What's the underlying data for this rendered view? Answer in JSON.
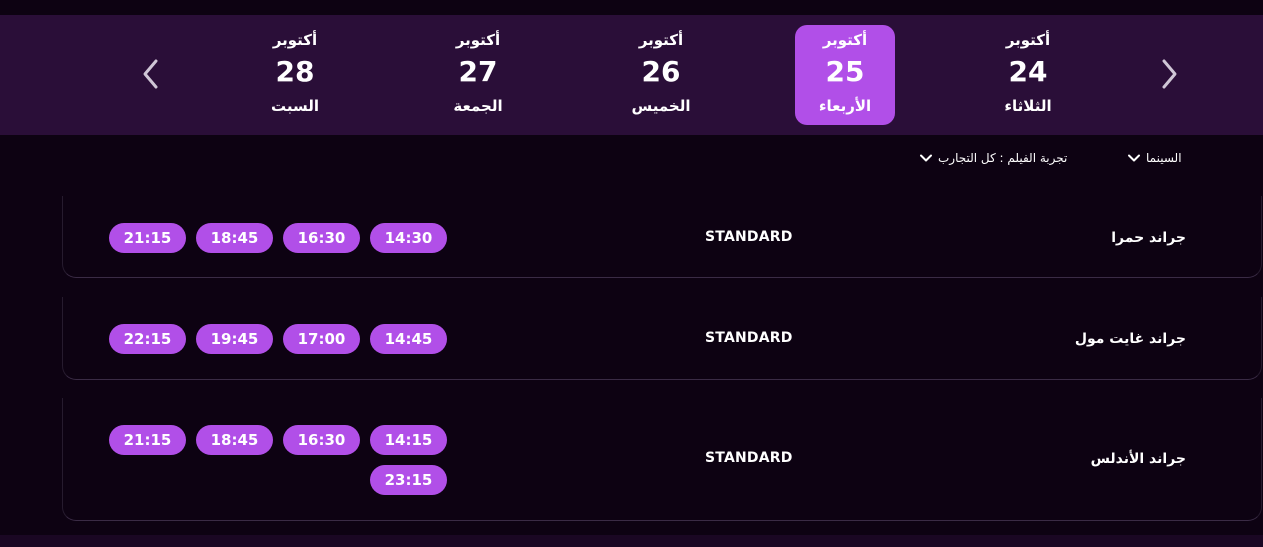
{
  "dates": [
    {
      "month": "أكتوبر",
      "day": "24",
      "weekday": "الثلاثاء",
      "selected": false
    },
    {
      "month": "أكتوبر",
      "day": "25",
      "weekday": "الأربعاء",
      "selected": true
    },
    {
      "month": "أكتوبر",
      "day": "26",
      "weekday": "الخميس",
      "selected": false
    },
    {
      "month": "أكتوبر",
      "day": "27",
      "weekday": "الجمعة",
      "selected": false
    },
    {
      "month": "أكتوبر",
      "day": "28",
      "weekday": "السبت",
      "selected": false
    }
  ],
  "filters": {
    "cinema_label": "السينما",
    "experience_label": "تجربة الفيلم : كل التجارب"
  },
  "showtimes": [
    {
      "cinema": "جراند حمرا",
      "format": "STANDARD",
      "times": [
        "14:30",
        "16:30",
        "18:45",
        "21:15"
      ]
    },
    {
      "cinema": "جراند غايت مول",
      "format": "STANDARD",
      "times": [
        "14:45",
        "17:00",
        "19:45",
        "22:15"
      ]
    },
    {
      "cinema": "جراند الأندلس",
      "format": "STANDARD",
      "times": [
        "14:15",
        "16:30",
        "18:45",
        "21:15",
        "23:15"
      ]
    }
  ],
  "colors": {
    "accent": "#b14fe8",
    "datebar": "#2a0e38",
    "background": "#0d0212"
  },
  "icons": {
    "prev": "chevron-left-icon",
    "next": "chevron-right-icon",
    "dropdown": "chevron-down-icon"
  }
}
